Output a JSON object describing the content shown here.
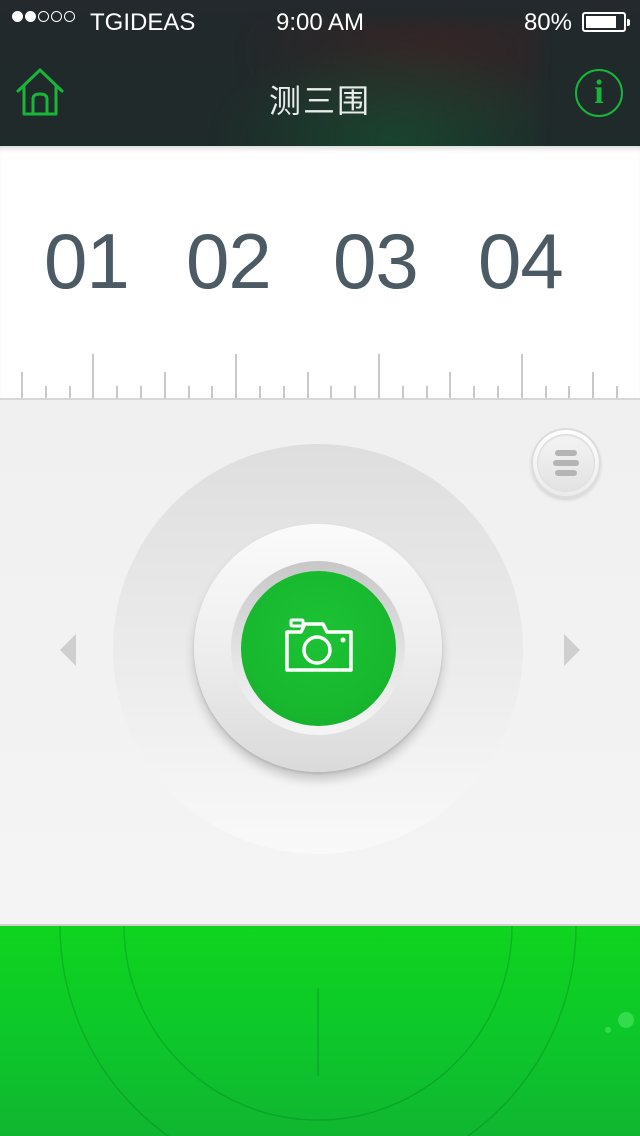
{
  "status_bar": {
    "carrier": "TGIDEAS",
    "time": "9:00 AM",
    "battery_percent": "80%",
    "signal_filled": 2,
    "signal_total": 5
  },
  "nav": {
    "title": "测三围",
    "home_icon": "home-icon",
    "info_icon": "info-icon",
    "info_glyph": "i"
  },
  "ruler": {
    "labels": [
      "01",
      "02",
      "03",
      "04"
    ]
  },
  "camera": {
    "shutter_icon": "camera-icon",
    "menu_icon": "menu-icon",
    "prev_icon": "chevron-left-icon",
    "next_icon": "chevron-right-icon"
  },
  "colors": {
    "accent": "#19b53a",
    "number_text": "#4b5a63",
    "header_bg": "#23292c",
    "footer_green": "#0fd41f"
  }
}
